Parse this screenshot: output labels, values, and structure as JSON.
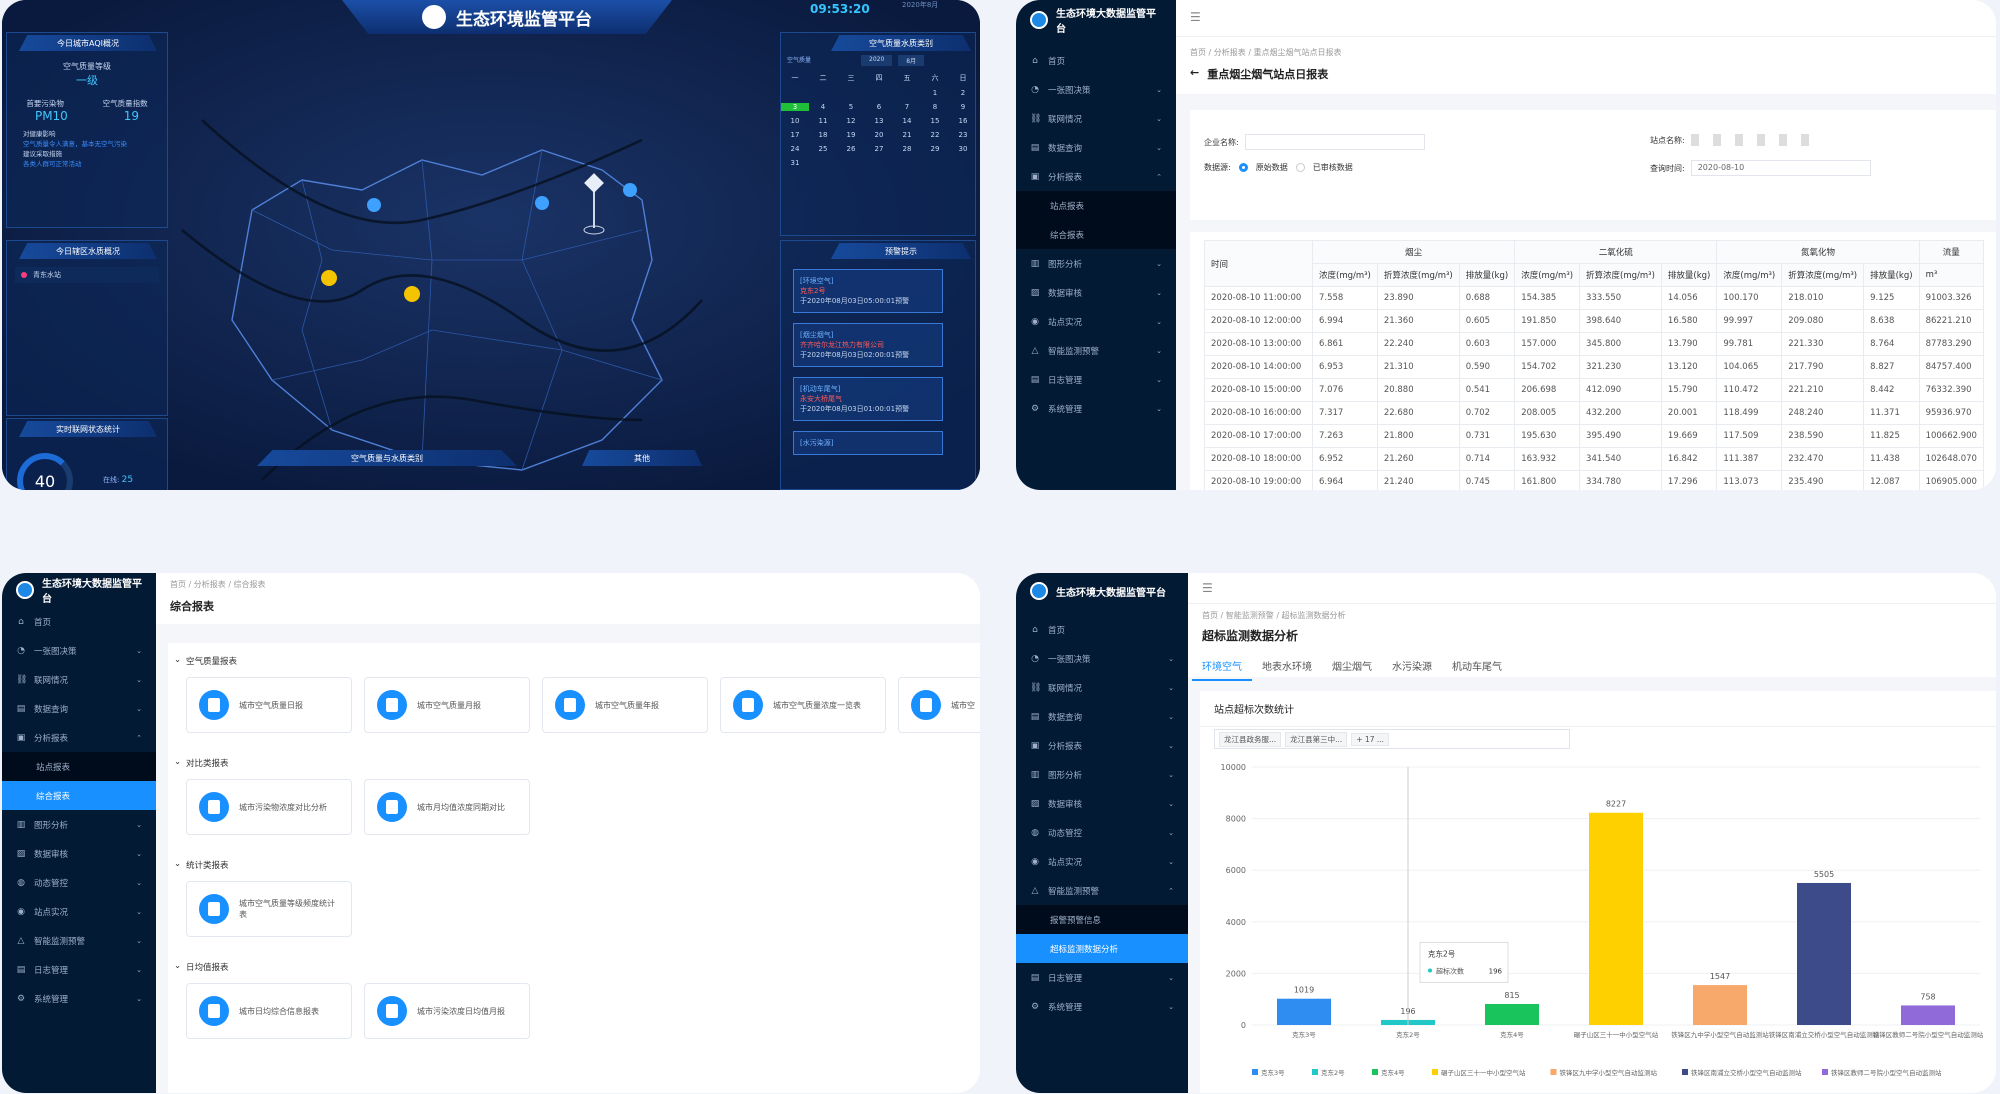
{
  "screen1": {
    "title": "生态环境监管平台",
    "time": "09:53:20",
    "date": "2020年8月",
    "aqi_panel": {
      "title": "今日城市AQI概况",
      "grade_label": "空气质量等级",
      "grade": "一级",
      "pollutant_label": "首要污染物",
      "pollutant": "PM10",
      "index_label": "空气质量指数",
      "index": "19",
      "tip_label": "对健康影响",
      "tip": "空气质量令人满意，基本无空气污染",
      "advice_label": "建议采取措施",
      "advice": "各类人群可正常活动"
    },
    "water_panel": {
      "title": "今日辖区水质概况",
      "item": "青东水站"
    },
    "network_panel": {
      "title": "实时联网状态统计",
      "count": "40",
      "online_label": "在线",
      "online": "25"
    },
    "calendar": {
      "title": "空气质量水质类别",
      "label": "空气质量",
      "year": "2020",
      "month": "8月",
      "weekdays": [
        "一",
        "二",
        "三",
        "四",
        "五",
        "六",
        "日"
      ],
      "days": [
        "",
        "",
        "",
        "",
        "",
        "1",
        "2",
        "3",
        "4",
        "5",
        "6",
        "7",
        "8",
        "9",
        "10",
        "11",
        "12",
        "13",
        "14",
        "15",
        "16",
        "17",
        "18",
        "19",
        "20",
        "21",
        "22",
        "23",
        "24",
        "25",
        "26",
        "27",
        "28",
        "29",
        "30",
        "31"
      ]
    },
    "warnings": {
      "title": "预警提示",
      "items": [
        {
          "type": "[环境空气]",
          "site": "克东2号",
          "text": "于2020年08月03日05:00:01预警"
        },
        {
          "type": "[烟尘烟气]",
          "site": "齐齐哈尔龙江热力有限公司",
          "text": "于2020年08月03日02:00:01预警"
        },
        {
          "type": "[机动车尾气]",
          "site": "永安大桥尾气",
          "text": "于2020年08月03日01:00:01预警"
        },
        {
          "type": "[水污染源]",
          "site": "",
          "text": ""
        }
      ]
    },
    "bottom_labels": [
      "空气质量与水质类别",
      "其他"
    ]
  },
  "screen2": {
    "brand": "生态环境大数据监管平台",
    "menu": [
      {
        "icon": "⌂",
        "label": "首页"
      },
      {
        "icon": "◔",
        "label": "一张图决策",
        "arrow": "⌄"
      },
      {
        "icon": "⛓",
        "label": "联网情况",
        "arrow": "⌄"
      },
      {
        "icon": "▤",
        "label": "数据查询",
        "arrow": "⌄"
      },
      {
        "icon": "▣",
        "label": "分析报表",
        "arrow": "⌃"
      },
      {
        "label": "站点报表",
        "sub": true
      },
      {
        "label": "综合报表",
        "sub": true
      },
      {
        "icon": "▥",
        "label": "图形分析",
        "arrow": "⌄"
      },
      {
        "icon": "▨",
        "label": "数据审核",
        "arrow": "⌄"
      },
      {
        "icon": "◉",
        "label": "站点实况",
        "arrow": "⌄"
      },
      {
        "icon": "△",
        "label": "智能监测预警",
        "arrow": "⌄"
      },
      {
        "icon": "▤",
        "label": "日志管理",
        "arrow": "⌄"
      },
      {
        "icon": "⚙",
        "label": "系统管理",
        "arrow": "⌄"
      }
    ],
    "breadcrumb": "首页 / 分析报表 / 重点烟尘烟气站点日报表",
    "page_title": "重点烟尘烟气站点日报表",
    "filters": {
      "company_label": "企业名称:",
      "site_label": "站点名称:",
      "source_label": "数据源:",
      "radio1": "原始数据",
      "radio2": "已审核数据",
      "date_label": "查询时间:",
      "date": "2020-08-10"
    },
    "table": {
      "time_header": "时间",
      "groups": [
        "烟尘",
        "二氧化硫",
        "氮氧化物",
        "流量"
      ],
      "sub": [
        "浓度(mg/m³)",
        "折算浓度(mg/m³)",
        "排放量(kg)"
      ],
      "flow_sub": "m³",
      "rows": [
        [
          "2020-08-10 11:00:00",
          "7.558",
          "23.890",
          "0.688",
          "154.385",
          "333.550",
          "14.056",
          "100.170",
          "218.010",
          "9.125",
          "91003.326"
        ],
        [
          "2020-08-10 12:00:00",
          "6.994",
          "21.360",
          "0.605",
          "191.850",
          "398.640",
          "16.580",
          "99.997",
          "209.080",
          "8.638",
          "86221.210"
        ],
        [
          "2020-08-10 13:00:00",
          "6.861",
          "22.240",
          "0.603",
          "157.000",
          "345.800",
          "13.790",
          "99.781",
          "221.330",
          "8.764",
          "87783.290"
        ],
        [
          "2020-08-10 14:00:00",
          "6.953",
          "21.310",
          "0.590",
          "154.702",
          "321.230",
          "13.120",
          "104.065",
          "217.790",
          "8.827",
          "84757.400"
        ],
        [
          "2020-08-10 15:00:00",
          "7.076",
          "20.880",
          "0.541",
          "206.698",
          "412.090",
          "15.790",
          "110.472",
          "221.210",
          "8.442",
          "76332.390"
        ],
        [
          "2020-08-10 16:00:00",
          "7.317",
          "22.680",
          "0.702",
          "208.005",
          "432.200",
          "20.001",
          "118.499",
          "248.240",
          "11.371",
          "95936.970"
        ],
        [
          "2020-08-10 17:00:00",
          "7.263",
          "21.800",
          "0.731",
          "195.630",
          "395.490",
          "19.669",
          "117.509",
          "238.590",
          "11.825",
          "100662.900"
        ],
        [
          "2020-08-10 18:00:00",
          "6.952",
          "21.260",
          "0.714",
          "163.932",
          "341.540",
          "16.842",
          "111.387",
          "232.470",
          "11.438",
          "102648.070"
        ],
        [
          "2020-08-10 19:00:00",
          "6.964",
          "21.240",
          "0.745",
          "161.800",
          "334.780",
          "17.296",
          "113.073",
          "235.490",
          "12.087",
          "106905.000"
        ]
      ]
    }
  },
  "screen3": {
    "brand": "生态环境大数据监管平台",
    "menu": [
      {
        "icon": "⌂",
        "label": "首页"
      },
      {
        "icon": "◔",
        "label": "一张图决策",
        "arrow": "⌄"
      },
      {
        "icon": "⛓",
        "label": "联网情况",
        "arrow": "⌄"
      },
      {
        "icon": "▤",
        "label": "数据查询",
        "arrow": "⌄"
      },
      {
        "icon": "▣",
        "label": "分析报表",
        "arrow": "⌃"
      },
      {
        "label": "站点报表",
        "sub": true
      },
      {
        "label": "综合报表",
        "sub": true,
        "active": true
      },
      {
        "icon": "▥",
        "label": "图形分析",
        "arrow": "⌄"
      },
      {
        "icon": "▨",
        "label": "数据审核",
        "arrow": "⌄"
      },
      {
        "icon": "◍",
        "label": "动态管控",
        "arrow": "⌄"
      },
      {
        "icon": "◉",
        "label": "站点实况",
        "arrow": "⌄"
      },
      {
        "icon": "△",
        "label": "智能监测预警",
        "arrow": "⌄"
      },
      {
        "icon": "▤",
        "label": "日志管理",
        "arrow": "⌄"
      },
      {
        "icon": "⚙",
        "label": "系统管理",
        "arrow": "⌄"
      }
    ],
    "breadcrumb": "首页 / 分析报表 / 综合报表",
    "page_title": "综合报表",
    "sections": [
      {
        "title": "空气质量报表",
        "tiles": [
          "城市空气质量日报",
          "城市空气质量月报",
          "城市空气质量年报",
          "城市空气质量浓度一览表",
          "城市空"
        ]
      },
      {
        "title": "对比类报表",
        "tiles": [
          "城市污染物浓度对比分析",
          "城市月均值浓度同期对比"
        ]
      },
      {
        "title": "统计类报表",
        "tiles": [
          "城市空气质量等级频度统计表"
        ]
      },
      {
        "title": "日均值报表",
        "tiles": [
          "城市日均综合信息报表",
          "城市污染浓度日均值月报"
        ]
      }
    ]
  },
  "screen4": {
    "brand": "生态环境大数据监管平台",
    "menu": [
      {
        "icon": "⌂",
        "label": "首页"
      },
      {
        "icon": "◔",
        "label": "一张图决策",
        "arrow": "⌄"
      },
      {
        "icon": "⛓",
        "label": "联网情况",
        "arrow": "⌄"
      },
      {
        "icon": "▤",
        "label": "数据查询",
        "arrow": "⌄"
      },
      {
        "icon": "▣",
        "label": "分析报表",
        "arrow": "⌄"
      },
      {
        "icon": "▥",
        "label": "图形分析",
        "arrow": "⌄"
      },
      {
        "icon": "▨",
        "label": "数据审核",
        "arrow": "⌄"
      },
      {
        "icon": "◍",
        "label": "动态管控",
        "arrow": "⌄"
      },
      {
        "icon": "◉",
        "label": "站点实况",
        "arrow": "⌄"
      },
      {
        "icon": "△",
        "label": "智能监测预警",
        "arrow": "⌃"
      },
      {
        "label": "报警预警信息",
        "sub": true
      },
      {
        "label": "超标监测数据分析",
        "sub": true,
        "active": true
      },
      {
        "icon": "▤",
        "label": "日志管理",
        "arrow": "⌄"
      },
      {
        "icon": "⚙",
        "label": "系统管理",
        "arrow": "⌄"
      }
    ],
    "breadcrumb": "首页 / 智能监测预警 / 超标监测数据分析",
    "page_title": "超标监测数据分析",
    "tabs": [
      "环境空气",
      "地表水环境",
      "烟尘烟气",
      "水污染源",
      "机动车尾气"
    ],
    "card_title": "站点超标次数统计",
    "select_tags": [
      "龙江县政务服...",
      "龙江县第三中...",
      "+ 17 ..."
    ],
    "tooltip": {
      "title": "克东2号",
      "label": "超标次数",
      "value": "196"
    }
  },
  "chart_data": {
    "type": "bar",
    "title": "站点超标次数统计",
    "categories": [
      "克东3号",
      "克东2号",
      "克东4号",
      "碾子山区三十一中小型空气站",
      "铁锋区九中学小型空气自动监测站",
      "铁锋区南浦立交桥小型空气自动监测站",
      "铁锋区教师二号院小型空气自动监测站"
    ],
    "values": [
      1019,
      196,
      815,
      8227,
      1547,
      5505,
      758
    ],
    "colors": [
      "#2f8cf0",
      "#22c7c7",
      "#19c45d",
      "#ffd000",
      "#f7a86b",
      "#3d4b8a",
      "#8f6ad8"
    ],
    "ylim": [
      0,
      10000
    ],
    "yticks": [
      0,
      2000,
      4000,
      6000,
      8000,
      10000
    ],
    "grid": true,
    "legend": "bottom"
  }
}
